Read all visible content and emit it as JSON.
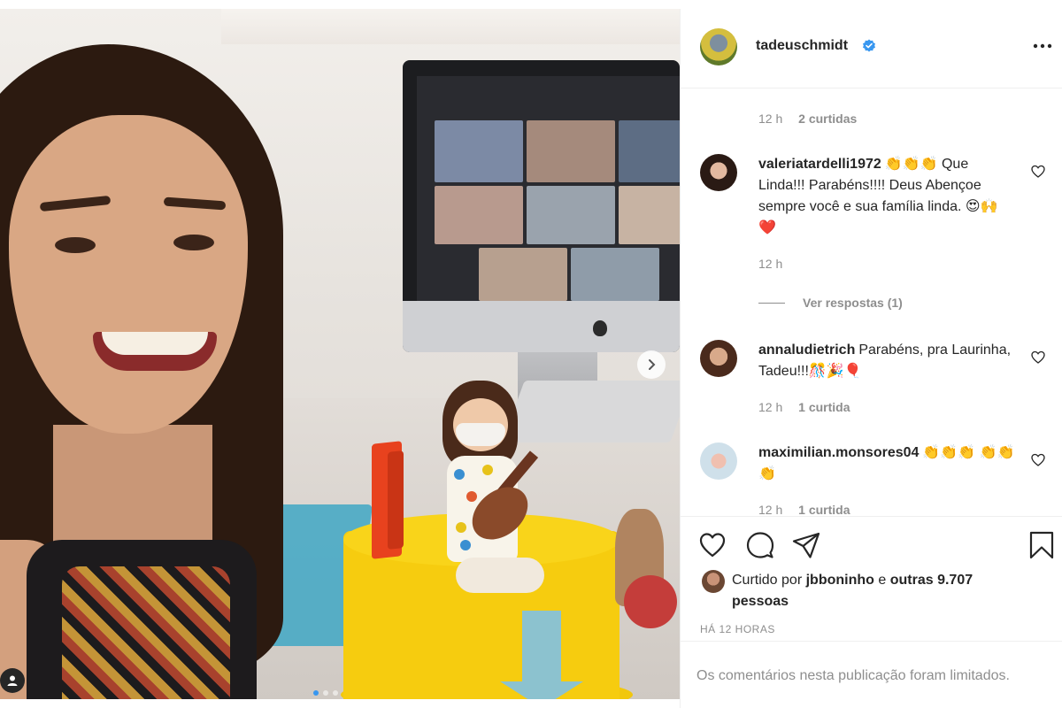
{
  "colors": {
    "accent": "#3897f0",
    "text": "#262626",
    "muted": "#8e8e8e",
    "heart_red": "#ed4956"
  },
  "post": {
    "username": "tadeuschmidt",
    "verified": true,
    "more_icon": "more-horizontal-icon",
    "caption_meta": {
      "time": "12 h",
      "likes": "2 curtidas"
    },
    "carousel": {
      "total": 3,
      "current": 1
    }
  },
  "comments": [
    {
      "user": "valeriatardelli1972",
      "text": "👏👏👏 Que Linda!!! Parabéns!!!! Deus Abençoe sempre você e sua família linda. 😍🙌❤️",
      "time": "12 h",
      "likes": "",
      "replies": "Ver respostas (1)"
    },
    {
      "user": "annaludietrich",
      "text": "Parabéns, pra Laurinha, Tadeu!!!🎊🎉🎈",
      "time": "12 h",
      "likes": "1 curtida",
      "replies": ""
    },
    {
      "user": "maximilian.monsores04",
      "text": "👏👏👏 👏👏👏",
      "time": "12 h",
      "likes": "1 curtida",
      "replies": ""
    }
  ],
  "actions": {
    "like_icon": "heart-icon",
    "comment_icon": "comment-icon",
    "share_icon": "share-icon",
    "save_icon": "bookmark-icon"
  },
  "likes": {
    "prefix": "Curtido por",
    "top_user": "jbboninho",
    "joiner": "e",
    "others": "outras 9.707 pessoas"
  },
  "time_ago": "HÁ 12 HORAS",
  "comments_limited": "Os comentários nesta publicação foram limitados."
}
